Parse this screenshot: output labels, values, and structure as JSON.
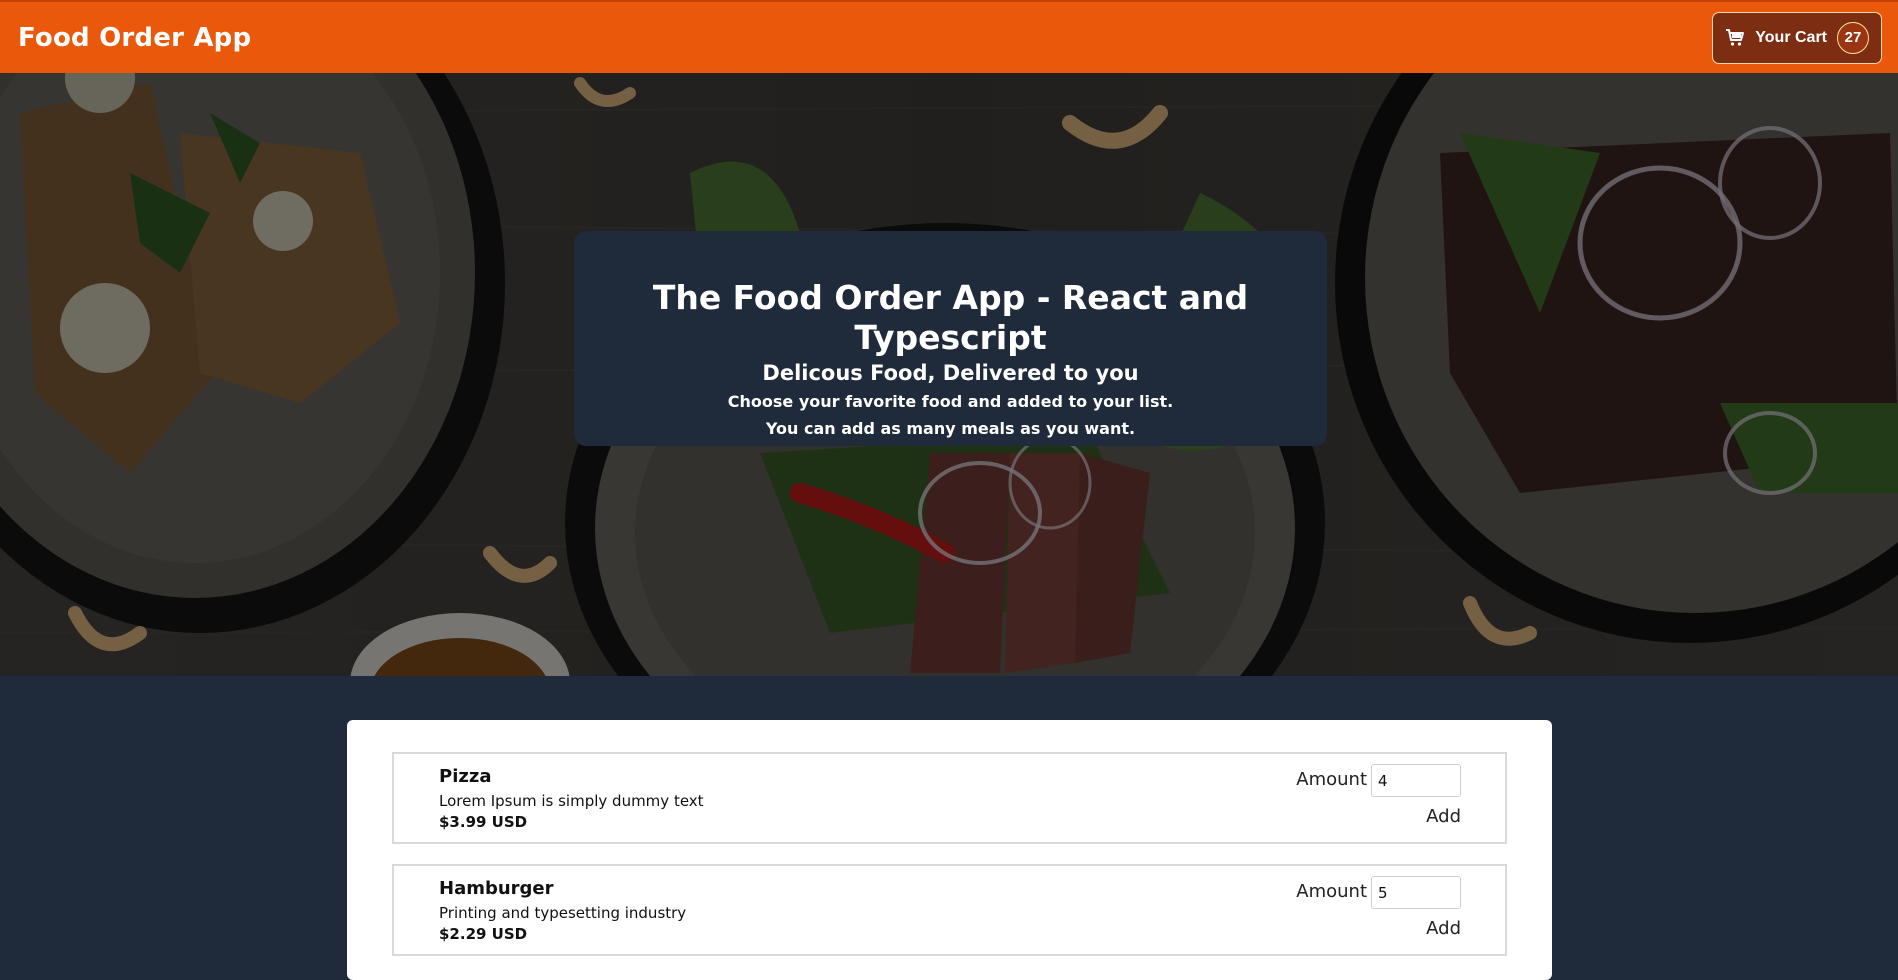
{
  "header": {
    "app_title": "Food Order App",
    "cart_label": "Your Cart",
    "cart_count": "27"
  },
  "summary": {
    "title": "The Food Order App - React and Typescript",
    "subtitle": "Delicous Food, Delivered to you",
    "line1": "Choose your favorite food and added to your list.",
    "line2": "You can add as many meals as you want."
  },
  "meals": [
    {
      "name": "Pizza",
      "description": "Lorem Ipsum is simply dummy text",
      "price": "$3.99 USD",
      "amount_label": "Amount",
      "amount_value": "4",
      "add_label": "Add"
    },
    {
      "name": "Hamburger",
      "description": "Printing and typesetting industry",
      "price": "$2.29 USD",
      "amount_label": "Amount",
      "amount_value": "5",
      "add_label": "Add"
    }
  ],
  "colors": {
    "header": "#ea580c",
    "cart_button": "#7c2d12",
    "page_background": "#1f2a3a",
    "card": "#ffffff"
  },
  "icons": {
    "cart": "shopping-cart-icon"
  }
}
